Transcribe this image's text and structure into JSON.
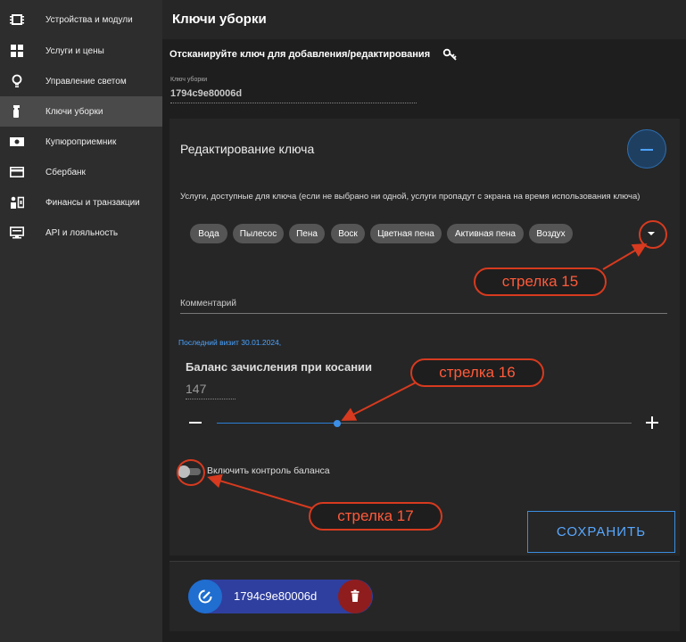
{
  "sidebar": {
    "items": [
      {
        "label": "Устройства и модули",
        "icon": "modules-icon",
        "active": false
      },
      {
        "label": "Услуги и цены",
        "icon": "grid-icon",
        "active": false
      },
      {
        "label": "Управление светом",
        "icon": "lightbulb-icon",
        "active": false
      },
      {
        "label": "Ключи уборки",
        "icon": "spray-bottle-icon",
        "active": true
      },
      {
        "label": "Купюроприемник",
        "icon": "banknote-icon",
        "active": false
      },
      {
        "label": "Сбербанк",
        "icon": "credit-card-icon",
        "active": false
      },
      {
        "label": "Финансы и транзакции",
        "icon": "finance-icon",
        "active": false
      },
      {
        "label": "API и лояльность",
        "icon": "api-icon",
        "active": false
      }
    ]
  },
  "header": {
    "title": "Ключи уборки"
  },
  "scan": {
    "prompt": "Отсканируйте ключ для добавления/редактирования",
    "icon": "key-icon"
  },
  "key_field": {
    "label": "Ключ уборки",
    "value": "1794c9e80006d"
  },
  "editor": {
    "title": "Редактирование ключа",
    "collapse_icon": "minus-icon",
    "services_help": "Услуги, доступные для ключа (если не выбрано ни одной, услуги пропадут с экрана на время использования ключа)",
    "services": [
      "Вода",
      "Пылесос",
      "Пена",
      "Воск",
      "Цветная пена",
      "Активная пена",
      "Воздух"
    ],
    "dropdown_icon": "caret-down-icon",
    "comment_label": "Комментарий",
    "last_visit": "Последний визит 30.01.2024,",
    "balance_title": "Баланс зачисления при косании",
    "balance_value": "147",
    "balance_slider_fraction": 0.29,
    "toggle_label": "Включить контроль баланса",
    "toggle_on": false,
    "save_label": "СОХРАНИТЬ"
  },
  "keys_list": [
    {
      "label": "1794c9e80006d",
      "edit_icon": "edit-icon",
      "delete_icon": "trash-icon"
    }
  ],
  "annotations": {
    "arrow15": "стрелка 15",
    "arrow16": "стрелка 16",
    "arrow17": "стрелка 17",
    "color": "#d73a1f"
  },
  "colors": {
    "accent": "#3b8fe8",
    "sidebar_bg": "#2d2d2d",
    "page_bg": "#1e1e1e",
    "danger": "#8f1d1d"
  }
}
